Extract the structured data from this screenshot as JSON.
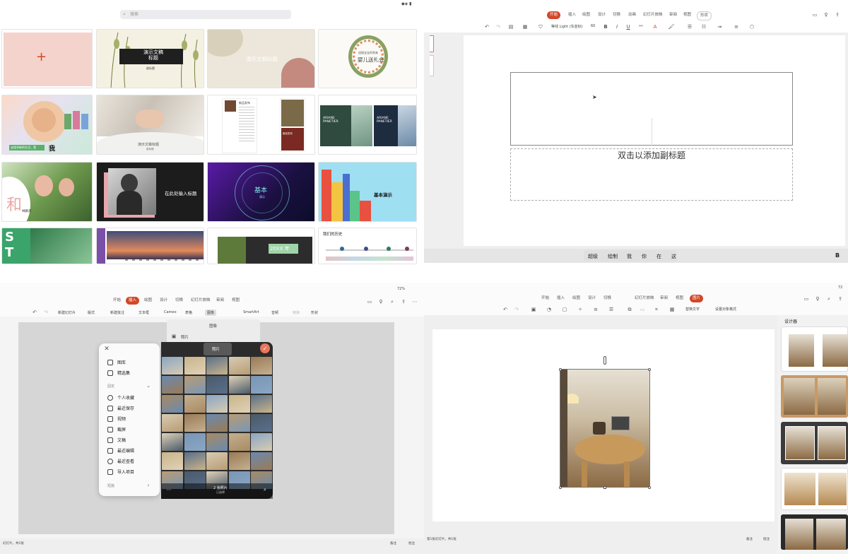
{
  "q1": {
    "status_icons": "◆◈ ▮",
    "search_placeholder": "搜索",
    "templates": {
      "t2_title": "演示文稿\n标题",
      "t2_sub": "副标题",
      "t3_title": "演示文稿标题",
      "t4_small": "迎接宝宝的到来",
      "t4_title": "婴儿送礼会",
      "t5_caption": "去找寻新的生活，我",
      "t5_big": "我",
      "t6_title": "演示文稿标题",
      "t6_sub": "副标题",
      "t7_head": "新品发布",
      "t7_side": "新品发布",
      "t8_name": "ARIANE PANETIER",
      "t8_name2": "ARIANE PANETIER",
      "t9_big": "和",
      "t9_sub": "林颖卉",
      "t10_title": "在此处输入标题",
      "t11_title": "基本",
      "t11_sub": "演示",
      "t12_title": "基本演示",
      "t13_big": "S\nT",
      "t15_title": "20XX 年",
      "t16_title": "我们的历史"
    }
  },
  "q2": {
    "tabs": [
      "开始",
      "插入",
      "绘图",
      "设计",
      "切换",
      "动画",
      "幻灯片放映",
      "审阅",
      "视图",
      "形状"
    ],
    "active_tab": "开始",
    "font_name": "等线 Light (东亚标)",
    "font_size": "60",
    "subtitle_placeholder": "双击以添加副标题",
    "ime_candidates": [
      "超级",
      "绘制",
      "我",
      "你",
      "在",
      "这"
    ],
    "bold_label": "B"
  },
  "q3": {
    "battery": "72%",
    "tabs": [
      "开始",
      "插入",
      "绘图",
      "设计",
      "切换",
      "幻灯片放映",
      "审阅",
      "视图"
    ],
    "active_tab": "插入",
    "toolbar": [
      "新建幻灯片",
      "版式",
      "新建批注",
      "文本框",
      "Cameo",
      "表格",
      "图像",
      "SmartArt",
      "音频",
      "链接",
      "形状"
    ],
    "popover_title": "图像",
    "popover_item": "照片",
    "photos_label": "照片",
    "menu": {
      "items_top": [
        "图库",
        "精选集"
      ],
      "section": "固定",
      "items": [
        "个人收藏",
        "最近保存",
        "视频",
        "截屏",
        "文稿",
        "最近编辑",
        "最近查看",
        "导入项目"
      ],
      "footer": "短篇"
    },
    "selection_count": "2 张照片",
    "selection_sub": "已选择",
    "status_left": "幻灯片，共1张",
    "status_right": "备注",
    "status_right2": "批注"
  },
  "q4": {
    "battery": "72",
    "tabs": [
      "开始",
      "插入",
      "绘图",
      "设计",
      "切换",
      "幻灯片放映",
      "审阅",
      "视图",
      "图片"
    ],
    "active_tab": "图片",
    "alt_text": "替换文字",
    "set_style": "设置对象格式",
    "designer_title": "设计器",
    "status_left": "第1张幻灯片，共1张",
    "status_right": "备注",
    "status_right2": "批注"
  }
}
